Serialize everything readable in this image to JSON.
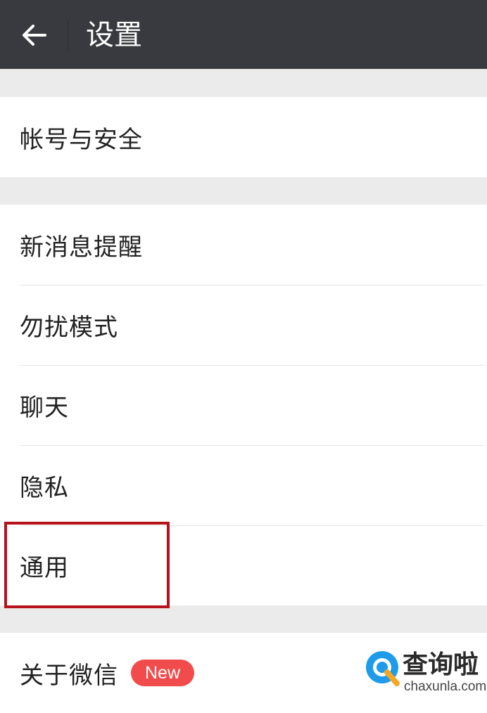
{
  "header": {
    "title": "设置",
    "back_icon": "arrow-left-icon"
  },
  "groups": [
    {
      "items": [
        {
          "label": "帐号与安全"
        }
      ]
    },
    {
      "items": [
        {
          "label": "新消息提醒"
        },
        {
          "label": "勿扰模式"
        },
        {
          "label": "聊天"
        },
        {
          "label": "隐私"
        },
        {
          "label": "通用"
        }
      ]
    },
    {
      "items": [
        {
          "label": "关于微信",
          "badge": "New"
        }
      ]
    }
  ],
  "watermark": {
    "name": "查询啦",
    "url": "chaxunla.com"
  },
  "colors": {
    "header_bg": "#393a3f",
    "page_bg": "#ebebeb",
    "badge": "#f24b4b",
    "highlight": "#b5121b"
  }
}
